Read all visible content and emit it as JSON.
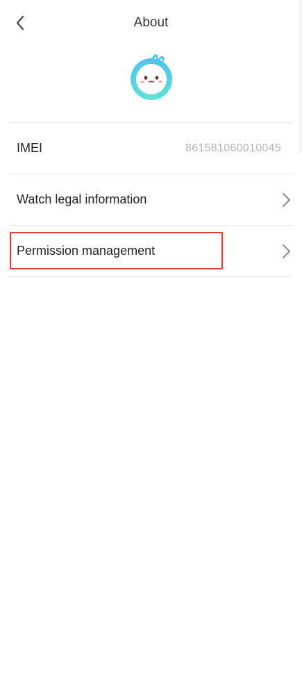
{
  "header": {
    "title": "About",
    "back_icon": "chevron-left-icon"
  },
  "logo": {
    "icon": "bunny-mascot-logo",
    "ring_color": "#4fd0e6",
    "face_color": "#ffffff"
  },
  "rows": [
    {
      "label": "IMEI",
      "value": "861581060010045"
    },
    {
      "label": "Watch legal information",
      "icon": "chevron-right-icon"
    },
    {
      "label": "Permission management",
      "icon": "chevron-right-icon"
    }
  ],
  "colors": {
    "highlight": "#e53935",
    "divider": "#e9e9e9",
    "value_text": "#b3b3b3"
  }
}
